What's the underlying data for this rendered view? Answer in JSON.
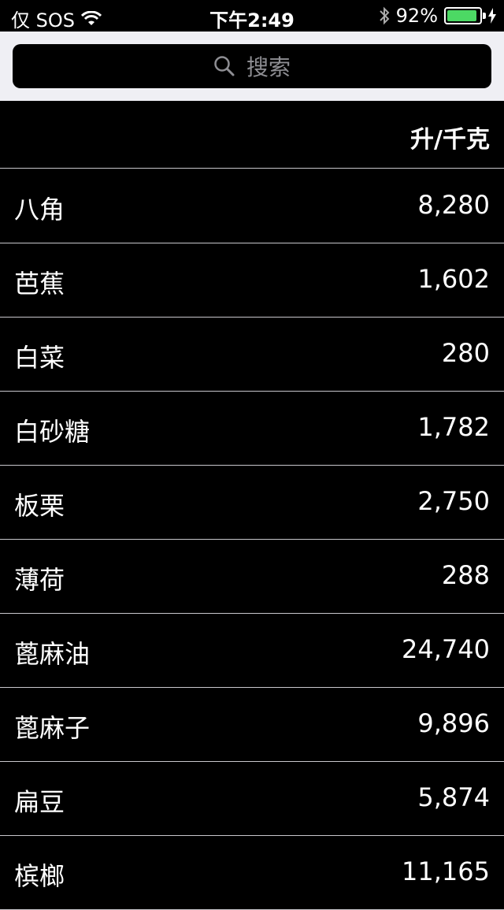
{
  "status_bar": {
    "carrier": "仅 SOS",
    "time": "下午2:49",
    "battery_percent": "92%",
    "battery_level": 0.92,
    "battery_color": "#4cd964"
  },
  "search": {
    "placeholder": "搜索"
  },
  "table": {
    "unit_header": "升/千克",
    "rows": [
      {
        "name": "八角",
        "value": "8,280"
      },
      {
        "name": "芭蕉",
        "value": "1,602"
      },
      {
        "name": "白菜",
        "value": "280"
      },
      {
        "name": "白砂糖",
        "value": "1,782"
      },
      {
        "name": "板栗",
        "value": "2,750"
      },
      {
        "name": "薄荷",
        "value": "288"
      },
      {
        "name": "蓖麻油",
        "value": "24,740"
      },
      {
        "name": "蓖麻子",
        "value": "9,896"
      },
      {
        "name": "扁豆",
        "value": "5,874"
      },
      {
        "name": "槟榔",
        "value": "11,165"
      }
    ]
  }
}
